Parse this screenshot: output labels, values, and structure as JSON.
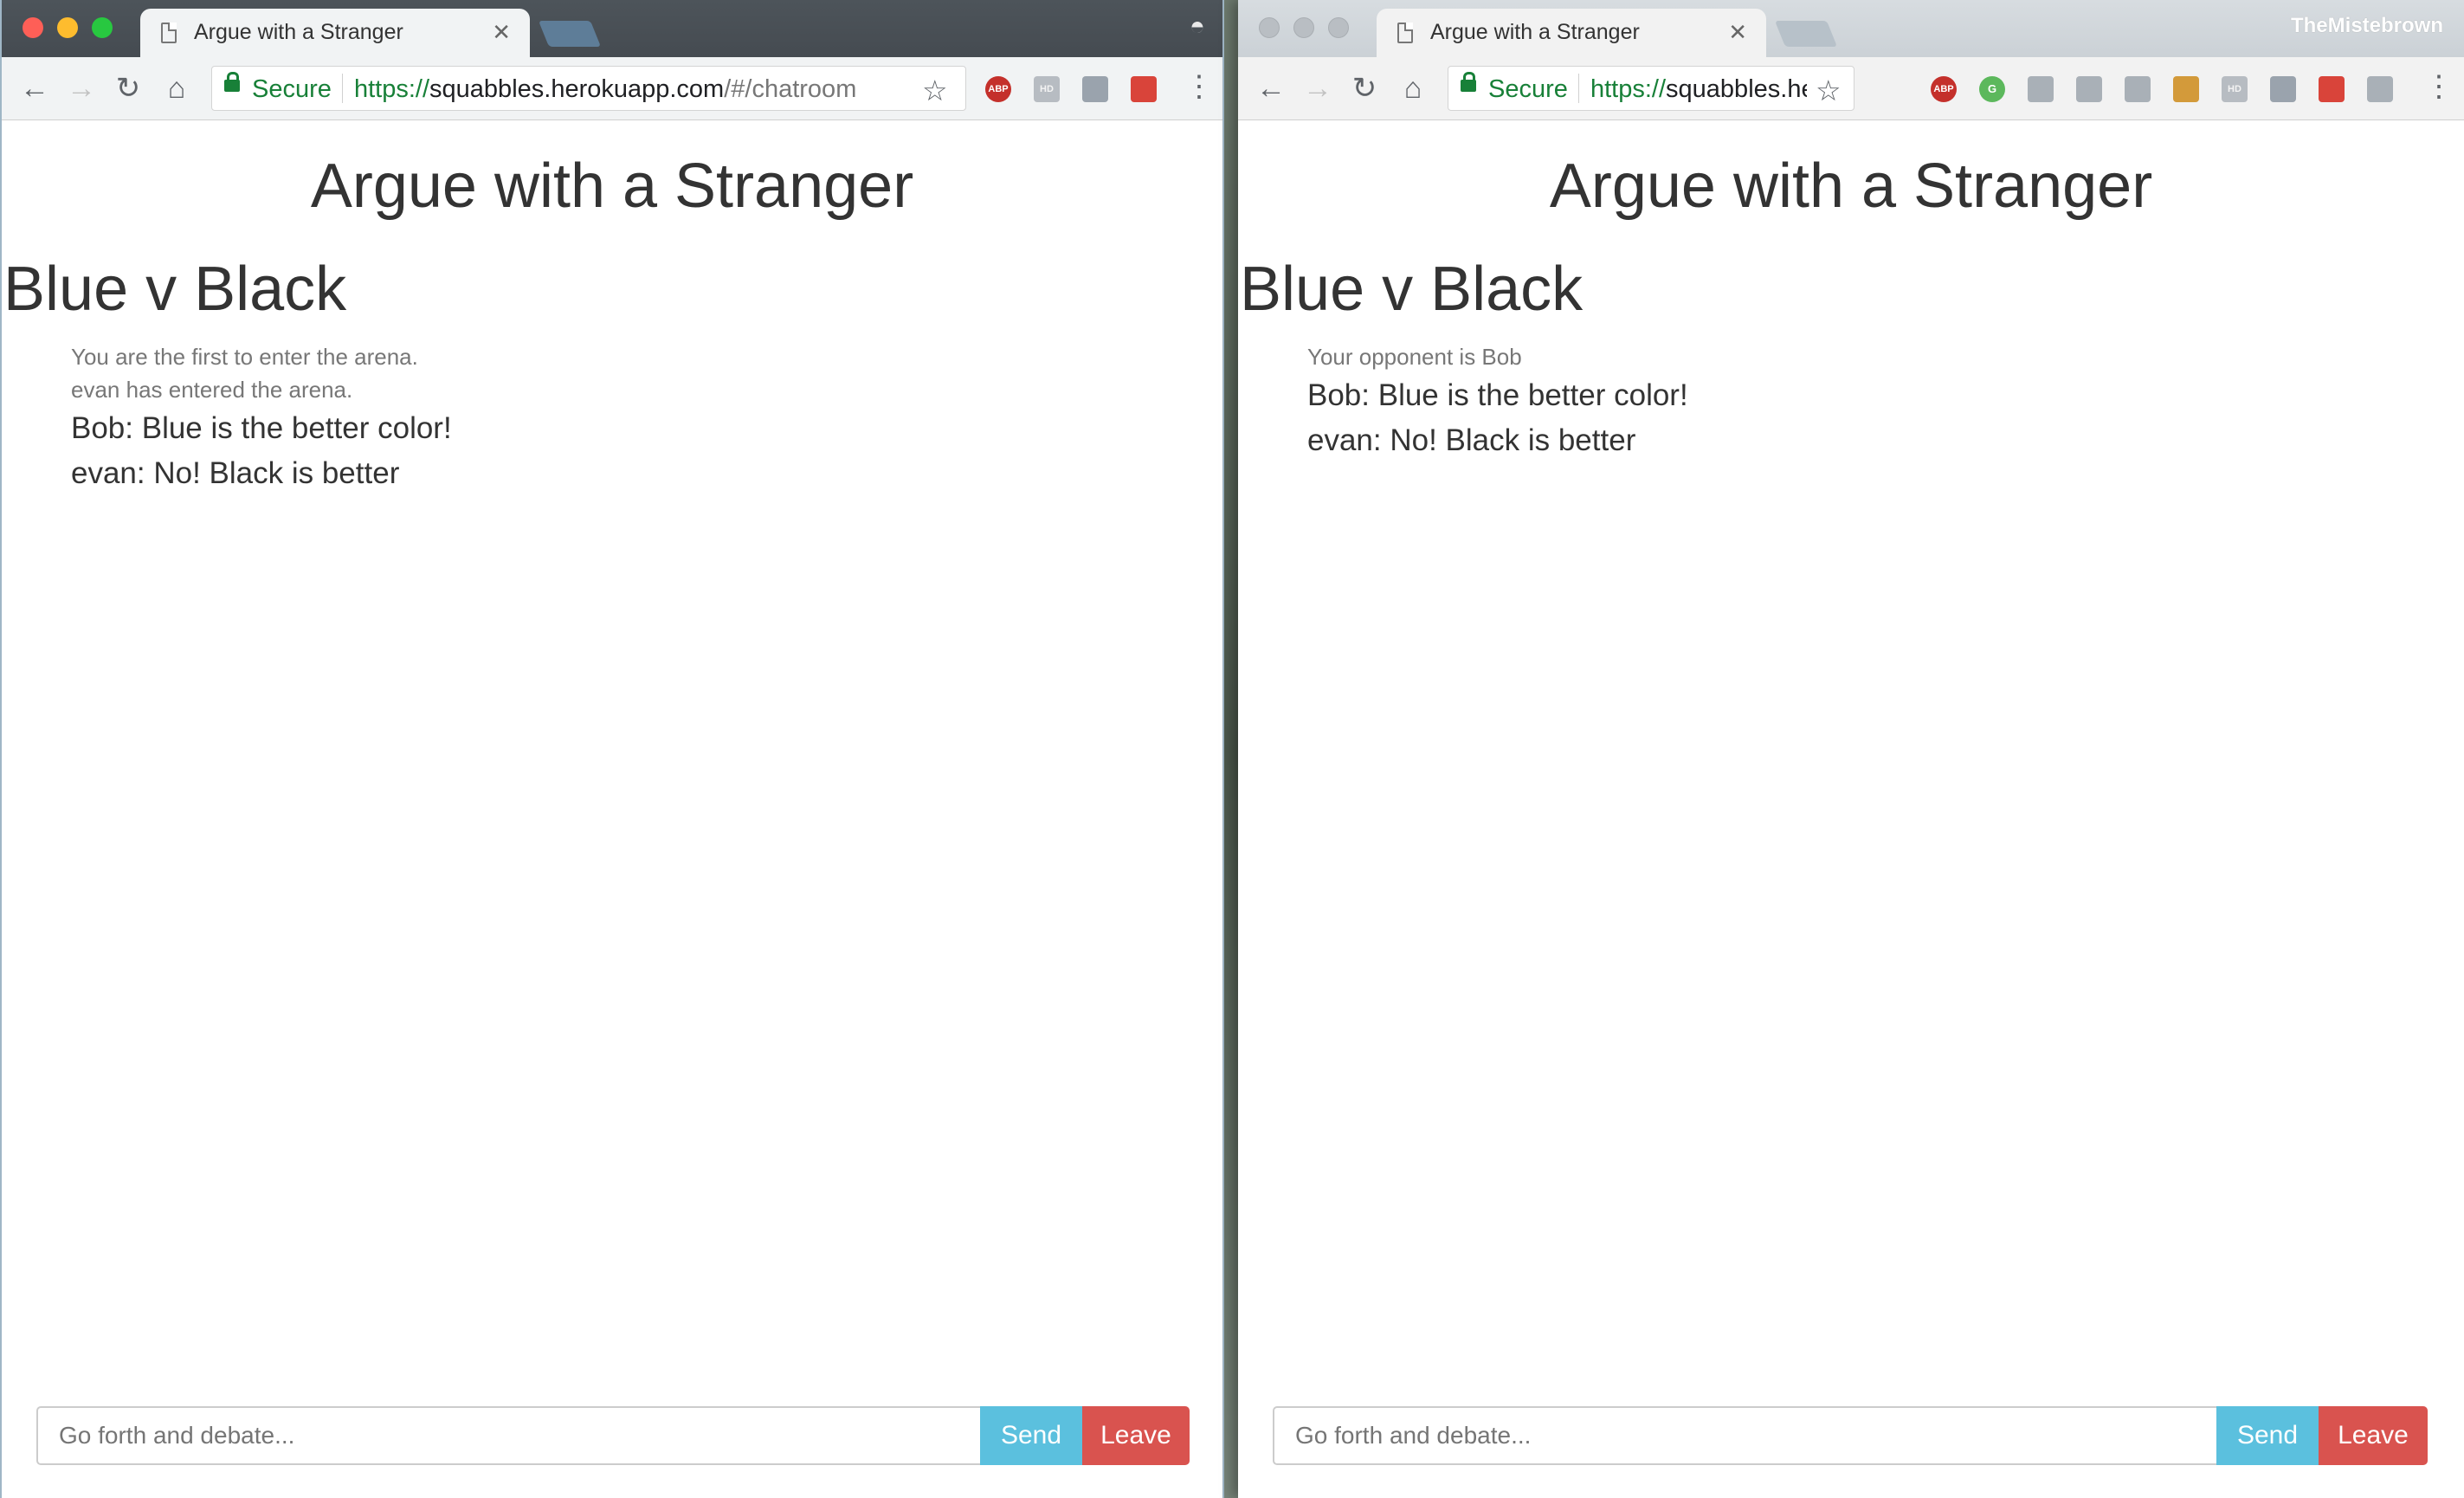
{
  "windows": [
    {
      "tab_title": "Argue with a Stranger",
      "secure_label": "Secure",
      "url": {
        "scheme": "https://",
        "host": "squabbles.herokuapp.com",
        "path": "/#/chatroom"
      },
      "extensions": [
        "ABP",
        "HD",
        "",
        ""
      ],
      "site_title": "Argue with a Stranger",
      "room_title": "Blue v Black",
      "system_messages": [
        "You are the first to enter the arena.",
        "evan has entered the arena."
      ],
      "messages": [
        "Bob: Blue is the better color!",
        "evan: No! Black is better"
      ],
      "input_placeholder": "Go forth and debate...",
      "send_label": "Send",
      "leave_label": "Leave"
    },
    {
      "tab_title": "Argue with a Stranger",
      "profile_name": "TheMistebrown",
      "secure_label": "Secure",
      "url": {
        "scheme": "https://",
        "host": "squabbles.her..."
      },
      "extensions": [
        "ABP",
        "G",
        "",
        "",
        "",
        "",
        "HD",
        "",
        "",
        ""
      ],
      "site_title": "Argue with a Stranger",
      "room_title": "Blue v Black",
      "system_messages": [
        "Your opponent is Bob"
      ],
      "messages": [
        "Bob: Blue is the better color!",
        "evan: No! Black is better"
      ],
      "input_placeholder": "Go forth and debate...",
      "send_label": "Send",
      "leave_label": "Leave"
    }
  ],
  "colors": {
    "send": "#5bc0de",
    "leave": "#d9534f",
    "secure": "#188038"
  }
}
